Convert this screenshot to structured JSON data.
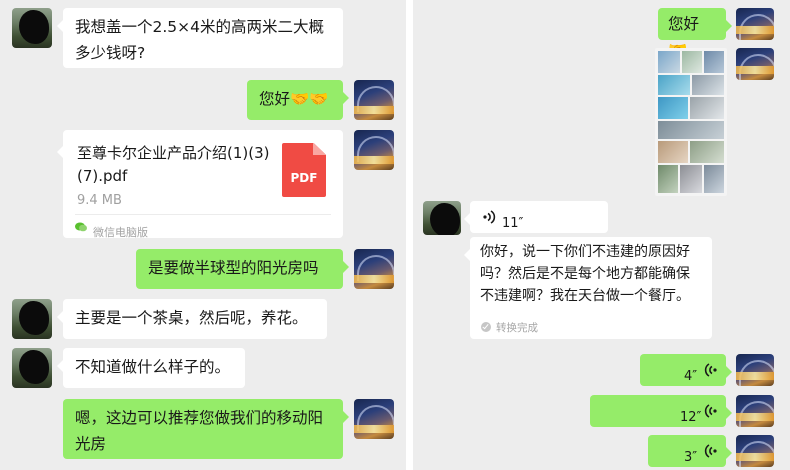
{
  "colors": {
    "chat_background": "#ededed",
    "bubble_self": "#95ec69",
    "bubble_peer": "#ffffff",
    "pdf_red": "#f04b44"
  },
  "left_chat": {
    "messages": [
      {
        "sender": "peer",
        "text": "我想盖一个2.5×4米的高两米二大概多少钱呀?"
      },
      {
        "sender": "self",
        "text": "您好🤝🤝"
      },
      {
        "sender": "self",
        "type": "file",
        "file_name": "至尊卡尔企业产品介绍(1)(3)(7).pdf",
        "file_size": "9.4 MB",
        "file_icon": "PDF",
        "source": "微信电脑版"
      },
      {
        "sender": "self",
        "text": "是要做半球型的阳光房吗"
      },
      {
        "sender": "peer",
        "text": "主要是一个茶桌，然后呢，养花。"
      },
      {
        "sender": "peer",
        "text": "不知道做什么样子的。"
      },
      {
        "sender": "self",
        "text": "嗯，这边可以推荐您做我们的移动阳光房"
      }
    ]
  },
  "right_chat": {
    "messages": [
      {
        "sender": "self",
        "text": "您好🤝"
      },
      {
        "sender": "self",
        "type": "image",
        "image_subject": "sunroom product photo collage"
      },
      {
        "sender": "peer",
        "type": "voice",
        "duration": "11″"
      },
      {
        "sender": "peer",
        "type": "transcript",
        "text": "你好，说一下你们不违建的原因好吗？然后是不是每个地方都能确保不违建啊？我在天台做一个餐厅。",
        "status": "转换完成"
      },
      {
        "sender": "self",
        "type": "voice",
        "duration": "4″"
      },
      {
        "sender": "self",
        "type": "voice",
        "duration": "12″"
      },
      {
        "sender": "self",
        "type": "voice",
        "duration": "3″"
      }
    ]
  }
}
